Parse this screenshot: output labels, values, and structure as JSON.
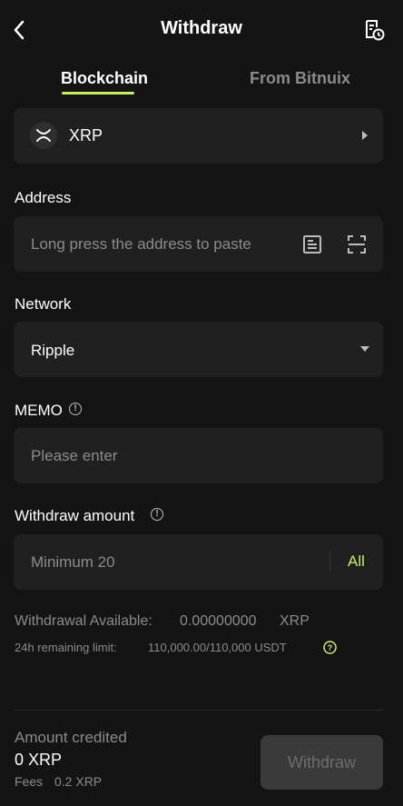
{
  "header": {
    "title": "Withdraw"
  },
  "tabs": [
    {
      "label": "Blockchain",
      "active": true
    },
    {
      "label": "From Bitnuix",
      "active": false
    }
  ],
  "coin": {
    "name": "XRP",
    "icon": "xrp-icon"
  },
  "address": {
    "label": "Address",
    "placeholder": "Long press the address to paste"
  },
  "network": {
    "label": "Network",
    "value": "Ripple"
  },
  "memo": {
    "label": "MEMO",
    "placeholder": "Please enter"
  },
  "amount": {
    "label": "Withdraw amount",
    "placeholder": "Minimum 20",
    "all_label": "All"
  },
  "available": {
    "label": "Withdrawal Available:",
    "value": "0.00000000",
    "unit": "XRP"
  },
  "limit": {
    "label": "24h remaining limit:",
    "value": "110,000.00/110,000 USDT"
  },
  "footer": {
    "credited_label": "Amount credited",
    "credited_value": "0 XRP",
    "fees_label": "Fees",
    "fees_value": "0.2 XRP",
    "button_label": "Withdraw"
  },
  "colors": {
    "accent": "#c8ee64",
    "background": "#141414",
    "card": "#202020"
  }
}
